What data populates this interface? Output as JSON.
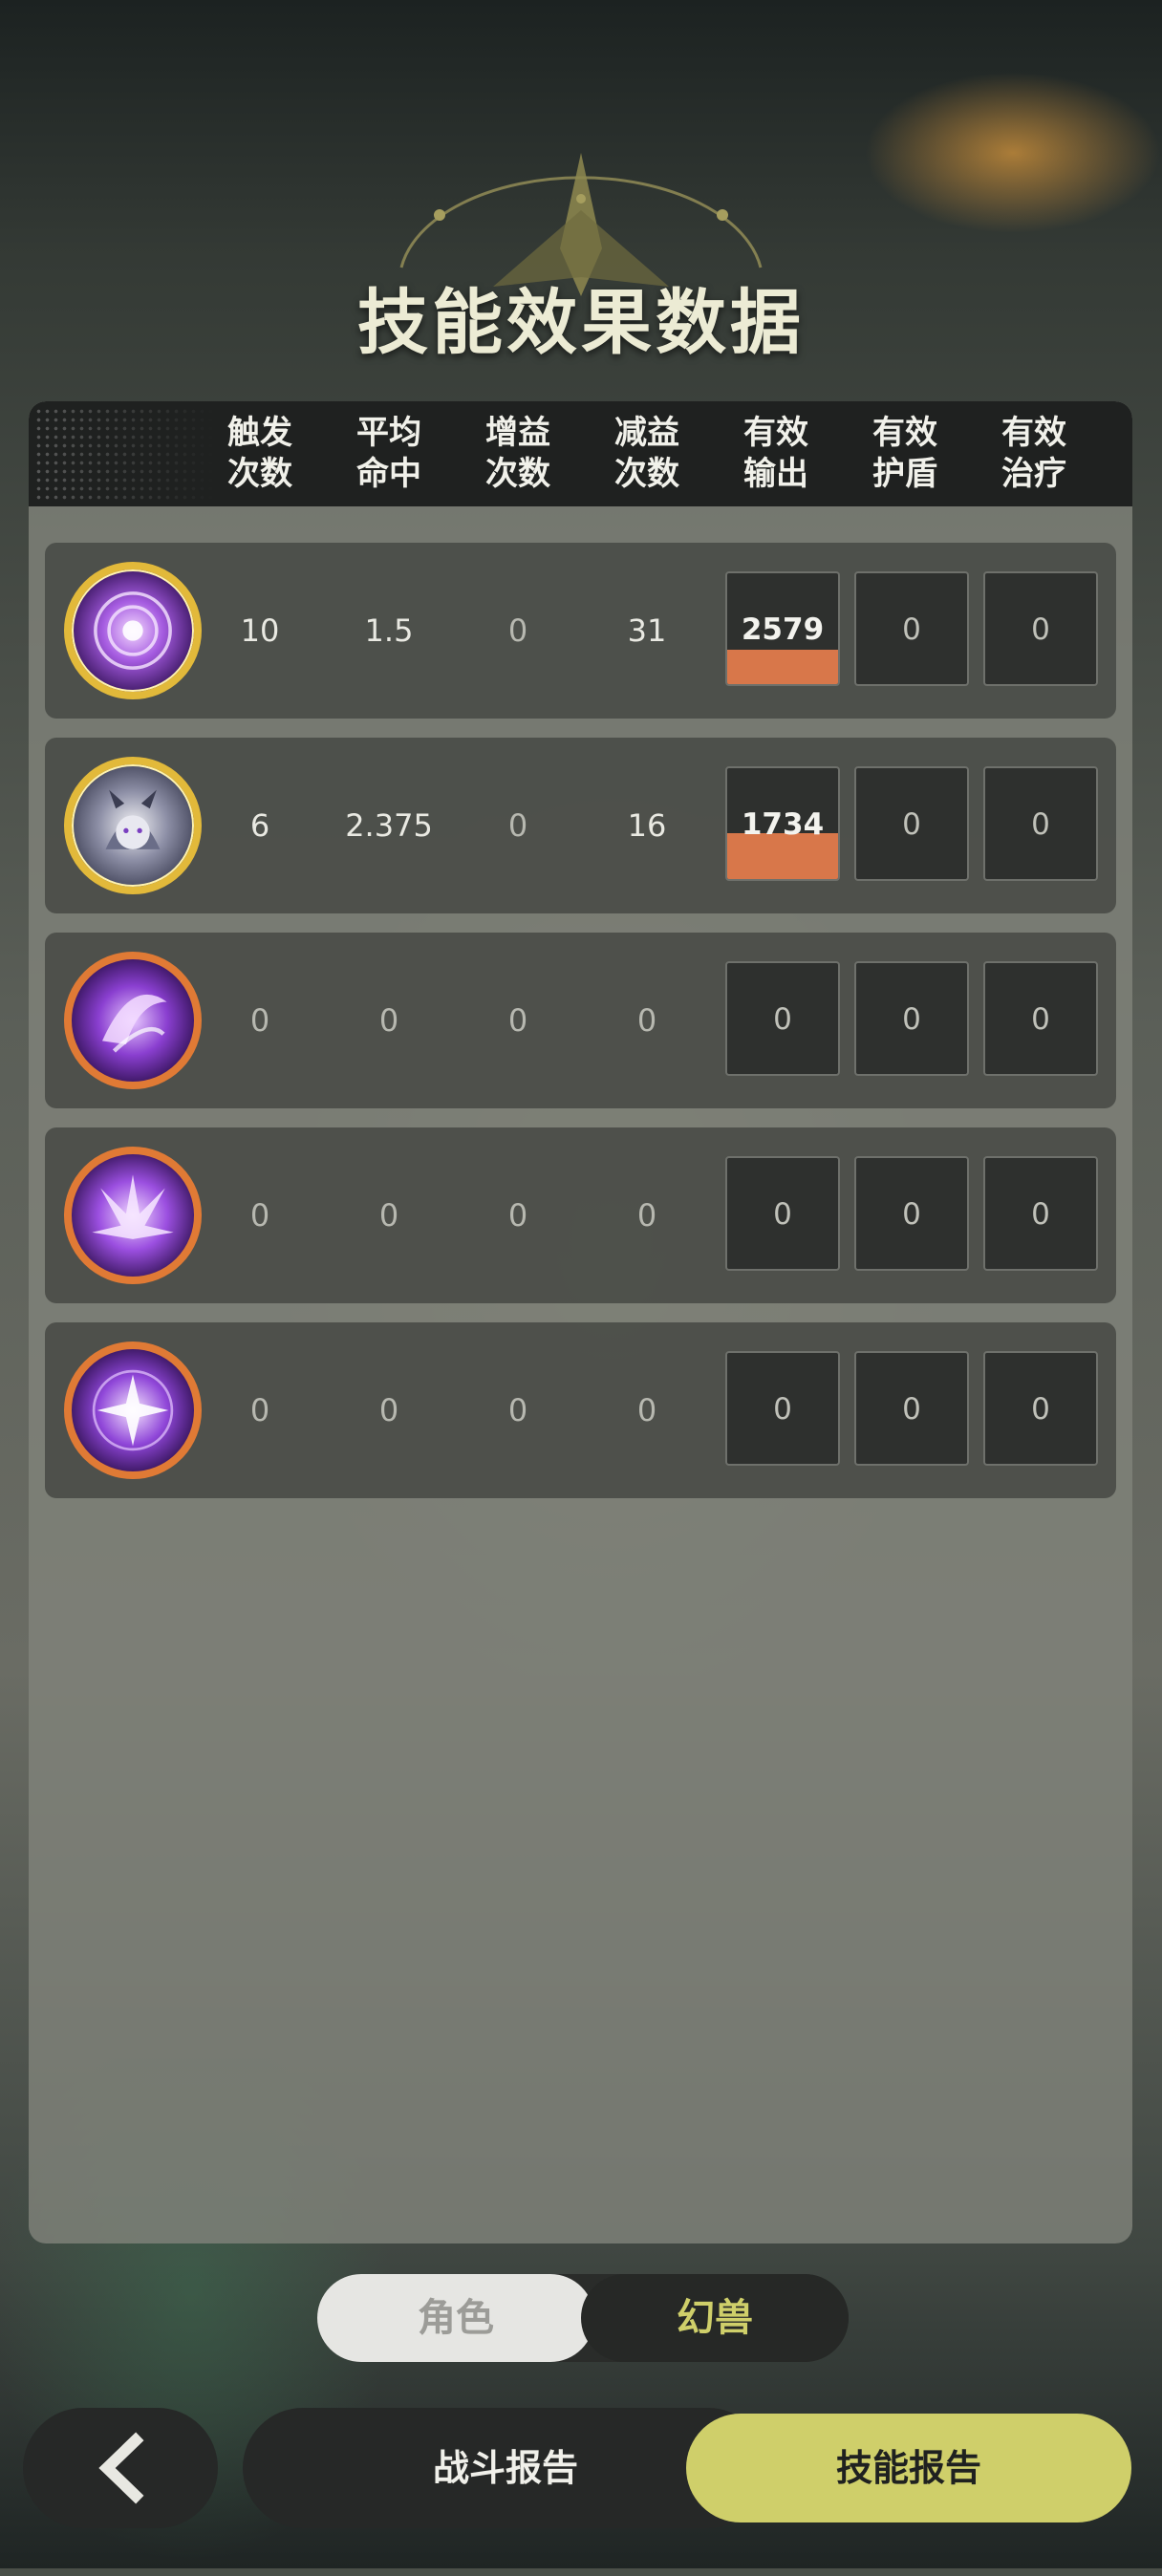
{
  "title": "技能效果数据",
  "columns": [
    {
      "line1": "触发",
      "line2": "次数"
    },
    {
      "line1": "平均",
      "line2": "命中"
    },
    {
      "line1": "增益",
      "line2": "次数"
    },
    {
      "line1": "减益",
      "line2": "次数"
    },
    {
      "line1": "有效",
      "line2": "输出"
    },
    {
      "line1": "有效",
      "line2": "护盾"
    },
    {
      "line1": "有效",
      "line2": "治疗"
    }
  ],
  "rows": [
    {
      "icon": "vortex-skill-icon",
      "trigger": "10",
      "avg_hit": "1.5",
      "buff": "0",
      "debuff": "31",
      "damage": "2579万",
      "damage_share": 0.3,
      "shield": "0",
      "heal": "0"
    },
    {
      "icon": "beast-portrait-icon",
      "trigger": "6",
      "avg_hit": "2.375",
      "buff": "0",
      "debuff": "16",
      "damage": "1734万",
      "damage_share": 0.4,
      "shield": "0",
      "heal": "0"
    },
    {
      "icon": "slash-skill-icon",
      "trigger": "0",
      "avg_hit": "0",
      "buff": "0",
      "debuff": "0",
      "damage": "0",
      "damage_share": 0,
      "shield": "0",
      "heal": "0"
    },
    {
      "icon": "burst-skill-icon",
      "trigger": "0",
      "avg_hit": "0",
      "buff": "0",
      "debuff": "0",
      "damage": "0",
      "damage_share": 0,
      "shield": "0",
      "heal": "0"
    },
    {
      "icon": "star-skill-icon",
      "trigger": "0",
      "avg_hit": "0",
      "buff": "0",
      "debuff": "0",
      "damage": "0",
      "damage_share": 0,
      "shield": "0",
      "heal": "0"
    }
  ],
  "toggle": {
    "left": "角色",
    "right": "幻兽",
    "selected": "幻兽"
  },
  "buttons": {
    "back": "back-arrow-icon",
    "battle_report": "战斗报告",
    "skill_report": "技能报告"
  },
  "colors": {
    "accent": "#cfcf6a",
    "damage_bar": "#d8774a",
    "gold_ring": "#e2b93a",
    "orange_ring": "#e07a35"
  }
}
